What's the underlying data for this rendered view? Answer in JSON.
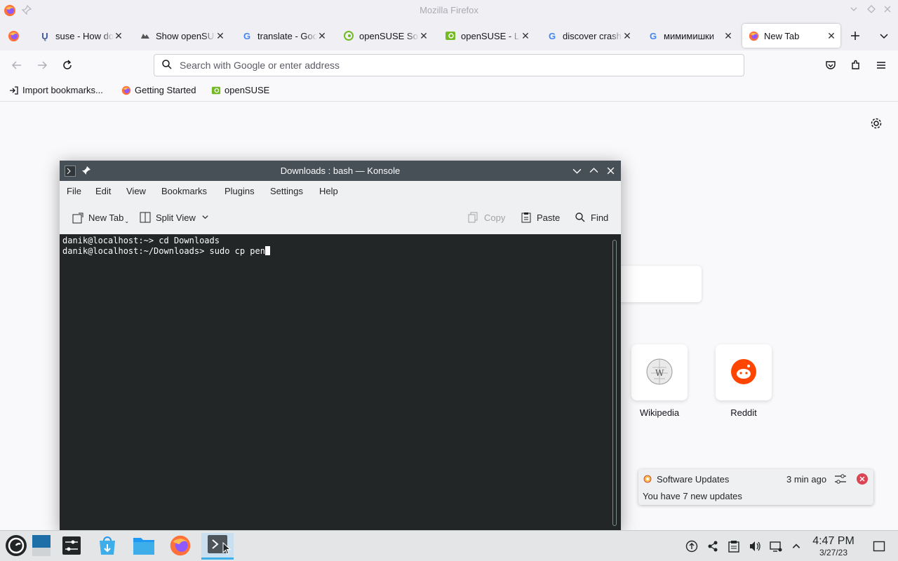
{
  "window": {
    "title": "Mozilla Firefox"
  },
  "tabs": [
    {
      "label": "suse - How do",
      "favicon": "stackoverflow-icon"
    },
    {
      "label": "Show openSUSE",
      "favicon": "github-icon"
    },
    {
      "label": "translate - Google",
      "favicon": "google-icon"
    },
    {
      "label": "openSUSE Software",
      "favicon": "opensuse-software-icon"
    },
    {
      "label": "openSUSE - Linux",
      "favicon": "opensuse-icon"
    },
    {
      "label": "discover crash",
      "favicon": "google-icon"
    },
    {
      "label": "мимимишки",
      "favicon": "google-icon"
    },
    {
      "label": "New Tab",
      "favicon": "firefox-icon",
      "active": true
    }
  ],
  "urlbar": {
    "placeholder": "Search with Google or enter address"
  },
  "bookmarks": [
    {
      "label": "Import bookmarks...",
      "icon": "import-icon"
    },
    {
      "label": "Getting Started",
      "icon": "firefox-icon"
    },
    {
      "label": "openSUSE",
      "icon": "opensuse-icon"
    }
  ],
  "newtab": {
    "shortcuts": [
      {
        "label": "Wikipedia",
        "icon": "wikipedia-icon"
      },
      {
        "label": "Reddit",
        "icon": "reddit-icon"
      }
    ]
  },
  "konsole": {
    "title": "Downloads : bash — Konsole",
    "menu": [
      "File",
      "Edit",
      "View",
      "Bookmarks",
      "Plugins",
      "Settings",
      "Help"
    ],
    "toolbar": {
      "new_tab": "New Tab",
      "split_view": "Split View",
      "copy": "Copy",
      "paste": "Paste",
      "find": "Find"
    },
    "terminal": {
      "line1": "danik@localhost:~> cd Downloads",
      "line2": "danik@localhost:~/Downloads> sudo cp pen"
    }
  },
  "notification": {
    "app": "Software Updates",
    "time": "3 min ago",
    "body": "You have 7 new updates"
  },
  "taskbar": {
    "clock_time": "4:47 PM",
    "clock_date": "3/27/23"
  },
  "colors": {
    "konsole_title": "#475057",
    "terminal_bg": "#232627",
    "accent": "#3daee9",
    "close_red": "#da4453"
  }
}
